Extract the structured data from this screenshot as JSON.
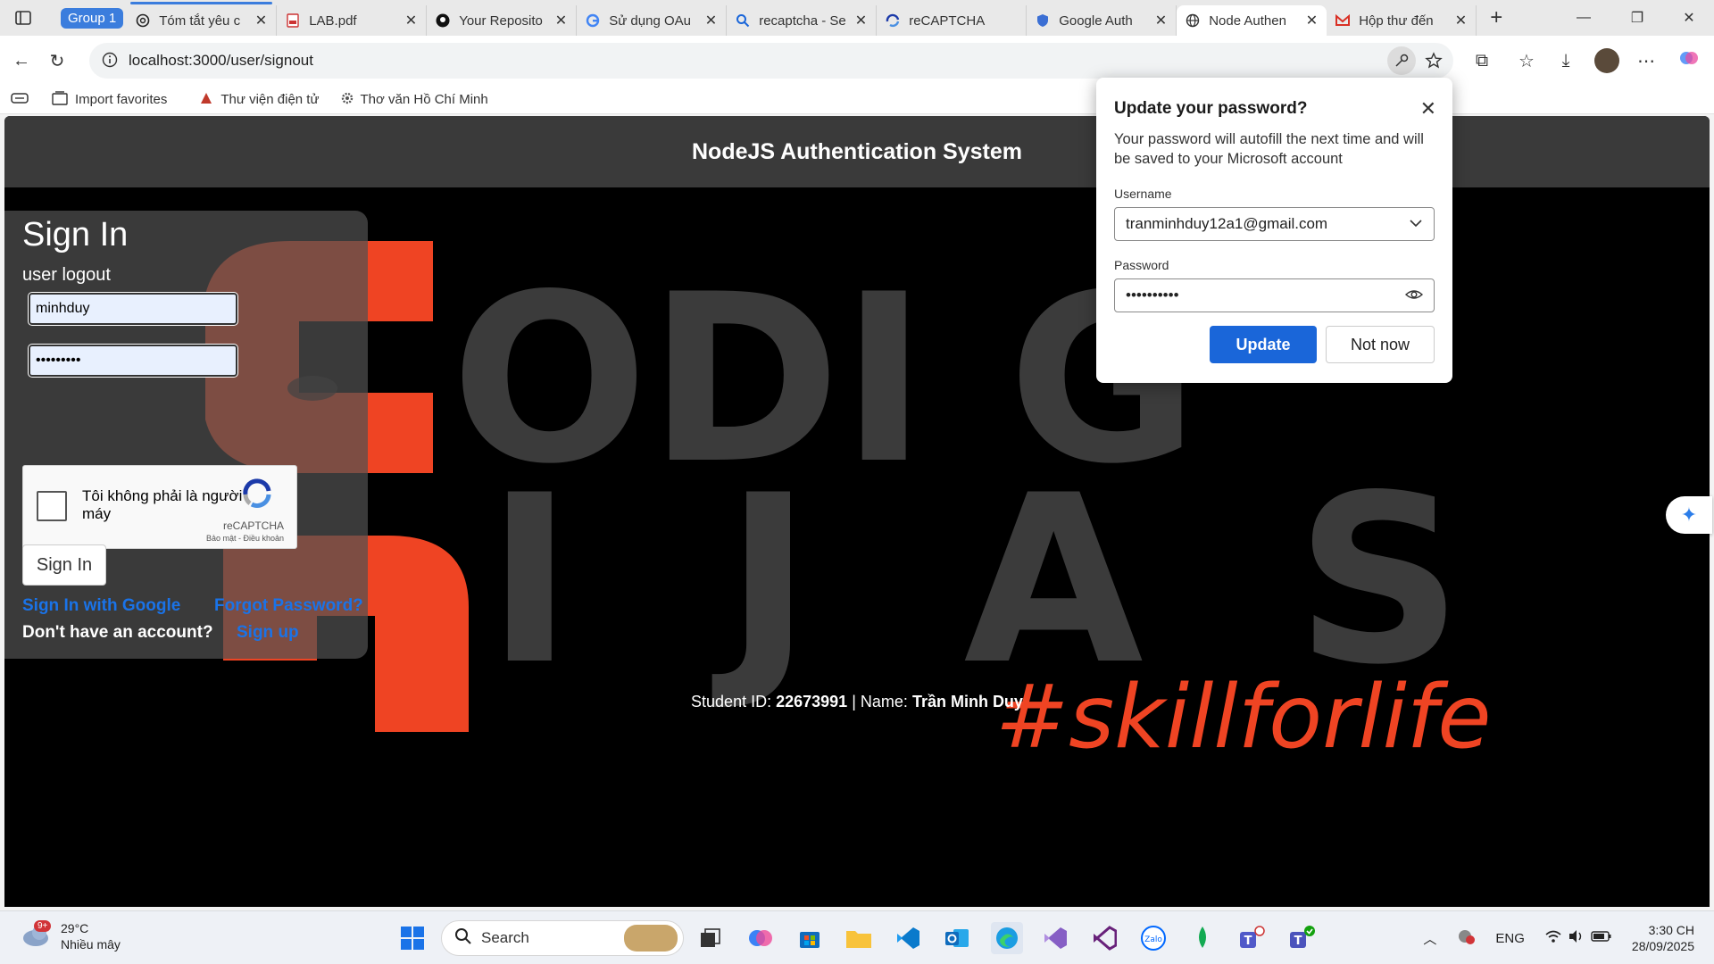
{
  "browser": {
    "tab_group_label": "Group 1",
    "tabs": [
      {
        "title": "Tóm tắt yêu c",
        "icon": "chatgpt-icon"
      },
      {
        "title": "LAB.pdf",
        "icon": "pdf-icon"
      },
      {
        "title": "Your Reposito",
        "icon": "github-icon"
      },
      {
        "title": "Sử dụng OAu",
        "icon": "google-icon"
      },
      {
        "title": "recaptcha - Se",
        "icon": "search-icon"
      },
      {
        "title": "reCAPTCHA",
        "icon": "recaptcha-icon"
      },
      {
        "title": "Google Auth",
        "icon": "shield-icon"
      },
      {
        "title": "Node Authen",
        "icon": "globe-icon"
      },
      {
        "title": "Hộp thư đến",
        "icon": "gmail-icon"
      }
    ],
    "url": "localhost:3000/user/signout",
    "favorites": [
      {
        "label": "Import favorites"
      },
      {
        "label": "Thư viện điện tử"
      },
      {
        "label": "Thơ văn Hồ Chí Minh"
      }
    ]
  },
  "site": {
    "header_title": "NodeJS Authentication System",
    "signin": {
      "title": "Sign In",
      "subtitle": "user logout",
      "username_value": "minhduy",
      "password_value": "•••••••••",
      "captcha_label": "Tôi không phải là người máy",
      "captcha_brand": "reCAPTCHA",
      "captcha_links": "Bảo mật - Điều khoản",
      "signin_button": "Sign In",
      "google_link": "Sign In with Google",
      "forgot_link": "Forgot Password?",
      "no_account_text": "Don't have an account?",
      "signup_link": "Sign up"
    },
    "student_label": "Student ID:",
    "student_id": "22673991",
    "name_label": "| Name:",
    "student_name": "Trần Minh Duy",
    "bg_text_line1": "ODI  G",
    "bg_text_line2": "I  J A S",
    "bg_tagline": "#skillforlife"
  },
  "password_popup": {
    "title": "Update your password?",
    "description": "Your password will autofill the next time and will be saved to your Microsoft account",
    "username_label": "Username",
    "username_value": "tranminhduy12a1@gmail.com",
    "password_label": "Password",
    "password_value": "••••••••••",
    "update_button": "Update",
    "not_now_button": "Not now"
  },
  "taskbar": {
    "weather_temp": "29°C",
    "weather_desc": "Nhiều mây",
    "weather_badge": "9+",
    "search_placeholder": "Search",
    "language": "ENG",
    "time": "3:30 CH",
    "date": "28/09/2025"
  },
  "colors": {
    "accent_blue": "#1a66d9",
    "brand_orange": "#ef4423",
    "page_bg": "#000000",
    "header_bg": "#3a3a3a"
  }
}
